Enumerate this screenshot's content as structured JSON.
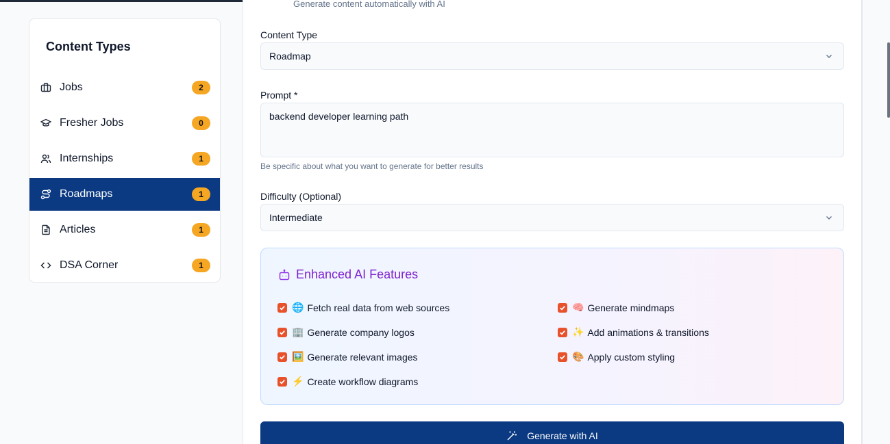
{
  "sidebar": {
    "title": "Content Types",
    "items": [
      {
        "label": "Jobs",
        "count": "2",
        "icon": "briefcase-icon"
      },
      {
        "label": "Fresher Jobs",
        "count": "0",
        "icon": "graduation-cap-icon"
      },
      {
        "label": "Internships",
        "count": "1",
        "icon": "users-icon"
      },
      {
        "label": "Roadmaps",
        "count": "1",
        "icon": "route-icon",
        "active": true
      },
      {
        "label": "Articles",
        "count": "1",
        "icon": "file-text-icon"
      },
      {
        "label": "DSA Corner",
        "count": "1",
        "icon": "code-icon"
      }
    ]
  },
  "form": {
    "subtitle": "Generate content automatically with AI",
    "content_type_label": "Content Type",
    "content_type_value": "Roadmap",
    "prompt_label": "Prompt *",
    "prompt_value": "backend developer learning path",
    "prompt_hint": "Be specific about what you want to generate for better results",
    "difficulty_label": "Difficulty (Optional)",
    "difficulty_value": "Intermediate"
  },
  "ai_features": {
    "title": "Enhanced AI Features",
    "left": [
      {
        "emoji": "🌐",
        "label": "Fetch real data from web sources",
        "checked": true
      },
      {
        "emoji": "🏢",
        "label": "Generate company logos",
        "checked": true
      },
      {
        "emoji": "🖼️",
        "label": "Generate relevant images",
        "checked": true
      },
      {
        "emoji": "⚡",
        "label": "Create workflow diagrams",
        "checked": true
      }
    ],
    "right": [
      {
        "emoji": "🧠",
        "label": "Generate mindmaps",
        "checked": true
      },
      {
        "emoji": "✨",
        "label": "Add animations & transitions",
        "checked": true
      },
      {
        "emoji": "🎨",
        "label": "Apply custom styling",
        "checked": true
      }
    ]
  },
  "generate_button": {
    "label": "Generate with AI",
    "icon": "magic-wand-icon"
  },
  "colors": {
    "primary": "#0b3a82",
    "badge": "#f5a623",
    "checkbox": "#e8522b",
    "ai_title": "#7e22ce"
  }
}
